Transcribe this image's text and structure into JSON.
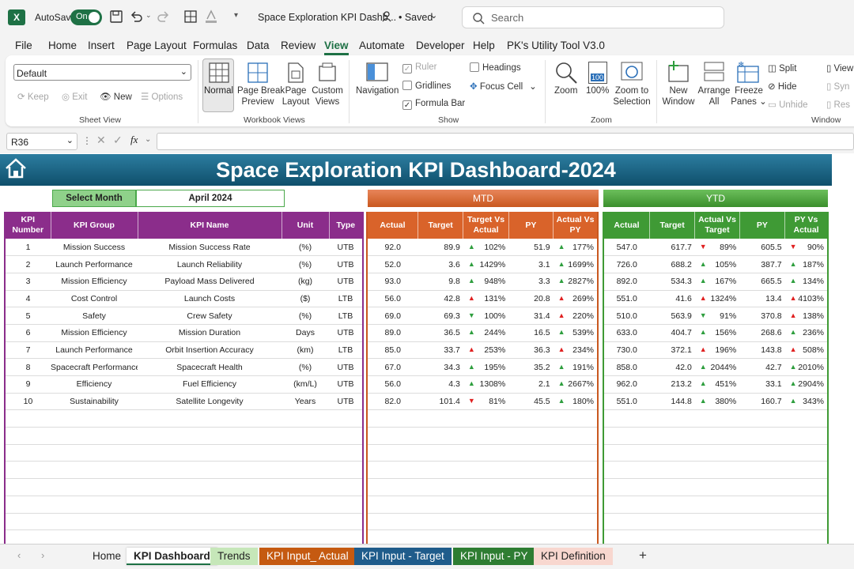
{
  "title_bar": {
    "autosave_label": "AutoSave",
    "autosave_state": "On",
    "file_name": "Space Exploration KPI Dashb...",
    "saved_status": "• Saved",
    "search_placeholder": "Search"
  },
  "menu": [
    "File",
    "Home",
    "Insert",
    "Page Layout",
    "Formulas",
    "Data",
    "Review",
    "View",
    "Automate",
    "Developer",
    "Help",
    "PK's Utility Tool V3.0"
  ],
  "menu_active": "View",
  "ribbon": {
    "sheet_view": {
      "dropdown": "Default",
      "keep": "Keep",
      "exit": "Exit",
      "new": "New",
      "options": "Options",
      "label": "Sheet View"
    },
    "workbook_views": {
      "normal": "Normal",
      "page_break_1": "Page Break",
      "page_break_2": "Preview",
      "page_layout_1": "Page",
      "page_layout_2": "Layout",
      "custom_1": "Custom",
      "custom_2": "Views",
      "label": "Workbook Views"
    },
    "show": {
      "navigation": "Navigation",
      "ruler": "Ruler",
      "gridlines": "Gridlines",
      "formula_bar": "Formula Bar",
      "headings": "Headings",
      "focus_cell": "Focus Cell",
      "label": "Show"
    },
    "zoom": {
      "zoom": "Zoom",
      "zoom100": "100%",
      "icon100": "100",
      "zoom_sel_1": "Zoom to",
      "zoom_sel_2": "Selection",
      "label": "Zoom"
    },
    "window": {
      "new_1": "New",
      "new_2": "Window",
      "arrange_1": "Arrange",
      "arrange_2": "All",
      "freeze_1": "Freeze",
      "freeze_2": "Panes",
      "split": "Split",
      "hide": "Hide",
      "unhide": "Unhide",
      "view": "View",
      "sync": "Syn",
      "reset": "Res",
      "label": "Window"
    }
  },
  "formula_bar": {
    "cell_ref": "R36",
    "fx": "fx",
    "formula": ""
  },
  "dashboard": {
    "title": "Space Exploration KPI Dashboard-2024",
    "select_month_label": "Select Month",
    "select_month_value": "April 2024",
    "mtd_label": "MTD",
    "ytd_label": "YTD",
    "kpi_headers": {
      "num": [
        "KPI",
        "Number"
      ],
      "group": "KPI Group",
      "name": "KPI Name",
      "unit": "Unit",
      "type": "Type"
    },
    "mtd_headers": {
      "actual": "Actual",
      "target": "Target",
      "tva": [
        "Target Vs",
        "Actual"
      ],
      "py": "PY",
      "avp": [
        "Actual Vs",
        "PY"
      ]
    },
    "ytd_headers": {
      "actual": "Actual",
      "target": "Target",
      "avt": [
        "Actual Vs",
        "Target"
      ],
      "py": "PY",
      "pvy": [
        "PY Vs",
        "Actual"
      ]
    },
    "colors": {
      "kpi_header": "#8b2d8b",
      "mtd_header": "#d9632a",
      "ytd_header": "#3f9a35",
      "up": "#2e9e3e",
      "down": "#e02020"
    },
    "rows": [
      {
        "num": "1",
        "group": "Mission Success",
        "name": "Mission Success Rate",
        "unit": "(%)",
        "type": "UTB",
        "m_act": "92.0",
        "m_tgt": "89.9",
        "m_tva": "102%",
        "m_tva_dir": "up",
        "m_py": "51.9",
        "m_avp": "177%",
        "m_avp_dir": "up",
        "y_act": "547.0",
        "y_tgt": "617.7",
        "y_avt": "89%",
        "y_avt_dir": "down",
        "y_py": "605.5",
        "y_pvy": "90%",
        "y_pvy_dir": "down"
      },
      {
        "num": "2",
        "group": "Launch Performance",
        "name": "Launch Reliability",
        "unit": "(%)",
        "type": "UTB",
        "m_act": "52.0",
        "m_tgt": "3.6",
        "m_tva": "1429%",
        "m_tva_dir": "up",
        "m_py": "3.1",
        "m_avp": "1699%",
        "m_avp_dir": "up",
        "y_act": "726.0",
        "y_tgt": "688.2",
        "y_avt": "105%",
        "y_avt_dir": "up",
        "y_py": "387.7",
        "y_pvy": "187%",
        "y_pvy_dir": "up"
      },
      {
        "num": "3",
        "group": "Mission Efficiency",
        "name": "Payload Mass Delivered",
        "unit": "(kg)",
        "type": "UTB",
        "m_act": "93.0",
        "m_tgt": "9.8",
        "m_tva": "948%",
        "m_tva_dir": "up",
        "m_py": "3.3",
        "m_avp": "2827%",
        "m_avp_dir": "up",
        "y_act": "892.0",
        "y_tgt": "534.3",
        "y_avt": "167%",
        "y_avt_dir": "up",
        "y_py": "665.5",
        "y_pvy": "134%",
        "y_pvy_dir": "up"
      },
      {
        "num": "4",
        "group": "Cost Control",
        "name": "Launch Costs",
        "unit": "($)",
        "type": "LTB",
        "m_act": "56.0",
        "m_tgt": "42.8",
        "m_tva": "131%",
        "m_tva_dir": "redup",
        "m_py": "20.8",
        "m_avp": "269%",
        "m_avp_dir": "redup",
        "y_act": "551.0",
        "y_tgt": "41.6",
        "y_avt": "1324%",
        "y_avt_dir": "redup",
        "y_py": "13.4",
        "y_pvy": "4103%",
        "y_pvy_dir": "redup"
      },
      {
        "num": "5",
        "group": "Safety",
        "name": "Crew Safety",
        "unit": "(%)",
        "type": "LTB",
        "m_act": "69.0",
        "m_tgt": "69.3",
        "m_tva": "100%",
        "m_tva_dir": "greendown",
        "m_py": "31.4",
        "m_avp": "220%",
        "m_avp_dir": "redup",
        "y_act": "510.0",
        "y_tgt": "563.9",
        "y_avt": "91%",
        "y_avt_dir": "greendown",
        "y_py": "370.8",
        "y_pvy": "138%",
        "y_pvy_dir": "redup"
      },
      {
        "num": "6",
        "group": "Mission Efficiency",
        "name": "Mission Duration",
        "unit": "Days",
        "type": "UTB",
        "m_act": "89.0",
        "m_tgt": "36.5",
        "m_tva": "244%",
        "m_tva_dir": "up",
        "m_py": "16.5",
        "m_avp": "539%",
        "m_avp_dir": "up",
        "y_act": "633.0",
        "y_tgt": "404.7",
        "y_avt": "156%",
        "y_avt_dir": "up",
        "y_py": "268.6",
        "y_pvy": "236%",
        "y_pvy_dir": "up"
      },
      {
        "num": "7",
        "group": "Launch Performance",
        "name": "Orbit Insertion Accuracy",
        "unit": "(km)",
        "type": "LTB",
        "m_act": "85.0",
        "m_tgt": "33.7",
        "m_tva": "253%",
        "m_tva_dir": "redup",
        "m_py": "36.3",
        "m_avp": "234%",
        "m_avp_dir": "redup",
        "y_act": "730.0",
        "y_tgt": "372.1",
        "y_avt": "196%",
        "y_avt_dir": "redup",
        "y_py": "143.8",
        "y_pvy": "508%",
        "y_pvy_dir": "redup"
      },
      {
        "num": "8",
        "group": "Spacecraft Performance",
        "name": "Spacecraft Health",
        "unit": "(%)",
        "type": "UTB",
        "m_act": "67.0",
        "m_tgt": "34.3",
        "m_tva": "195%",
        "m_tva_dir": "up",
        "m_py": "35.2",
        "m_avp": "191%",
        "m_avp_dir": "up",
        "y_act": "858.0",
        "y_tgt": "42.0",
        "y_avt": "2044%",
        "y_avt_dir": "up",
        "y_py": "42.7",
        "y_pvy": "2010%",
        "y_pvy_dir": "up"
      },
      {
        "num": "9",
        "group": "Efficiency",
        "name": "Fuel Efficiency",
        "unit": "(km/L)",
        "type": "UTB",
        "m_act": "56.0",
        "m_tgt": "4.3",
        "m_tva": "1308%",
        "m_tva_dir": "up",
        "m_py": "2.1",
        "m_avp": "2667%",
        "m_avp_dir": "up",
        "y_act": "962.0",
        "y_tgt": "213.2",
        "y_avt": "451%",
        "y_avt_dir": "up",
        "y_py": "33.1",
        "y_pvy": "2904%",
        "y_pvy_dir": "up"
      },
      {
        "num": "10",
        "group": "Sustainability",
        "name": "Satellite Longevity",
        "unit": "Years",
        "type": "UTB",
        "m_act": "82.0",
        "m_tgt": "101.4",
        "m_tva": "81%",
        "m_tva_dir": "down",
        "m_py": "45.5",
        "m_avp": "180%",
        "m_avp_dir": "up",
        "y_act": "551.0",
        "y_tgt": "144.8",
        "y_avt": "380%",
        "y_avt_dir": "up",
        "y_py": "160.7",
        "y_pvy": "343%",
        "y_pvy_dir": "up"
      }
    ],
    "empty_rows": 8
  },
  "sheet_tabs": [
    {
      "label": "Home",
      "bg": "",
      "color": "#222"
    },
    {
      "label": "KPI Dashboard",
      "bg": "#ffffff",
      "color": "#222",
      "active": true
    },
    {
      "label": "Trends",
      "bg": "#c6e7b9",
      "color": "#222"
    },
    {
      "label": "KPI Input_ Actual",
      "bg": "#c55a11",
      "color": "#ffffff"
    },
    {
      "label": "KPI Input - Target",
      "bg": "#1f5c8b",
      "color": "#ffffff"
    },
    {
      "label": "KPI Input - PY",
      "bg": "#2e7d32",
      "color": "#ffffff"
    },
    {
      "label": "KPI Definition",
      "bg": "#f8d7cf",
      "color": "#222"
    }
  ],
  "add_sheet": "+"
}
